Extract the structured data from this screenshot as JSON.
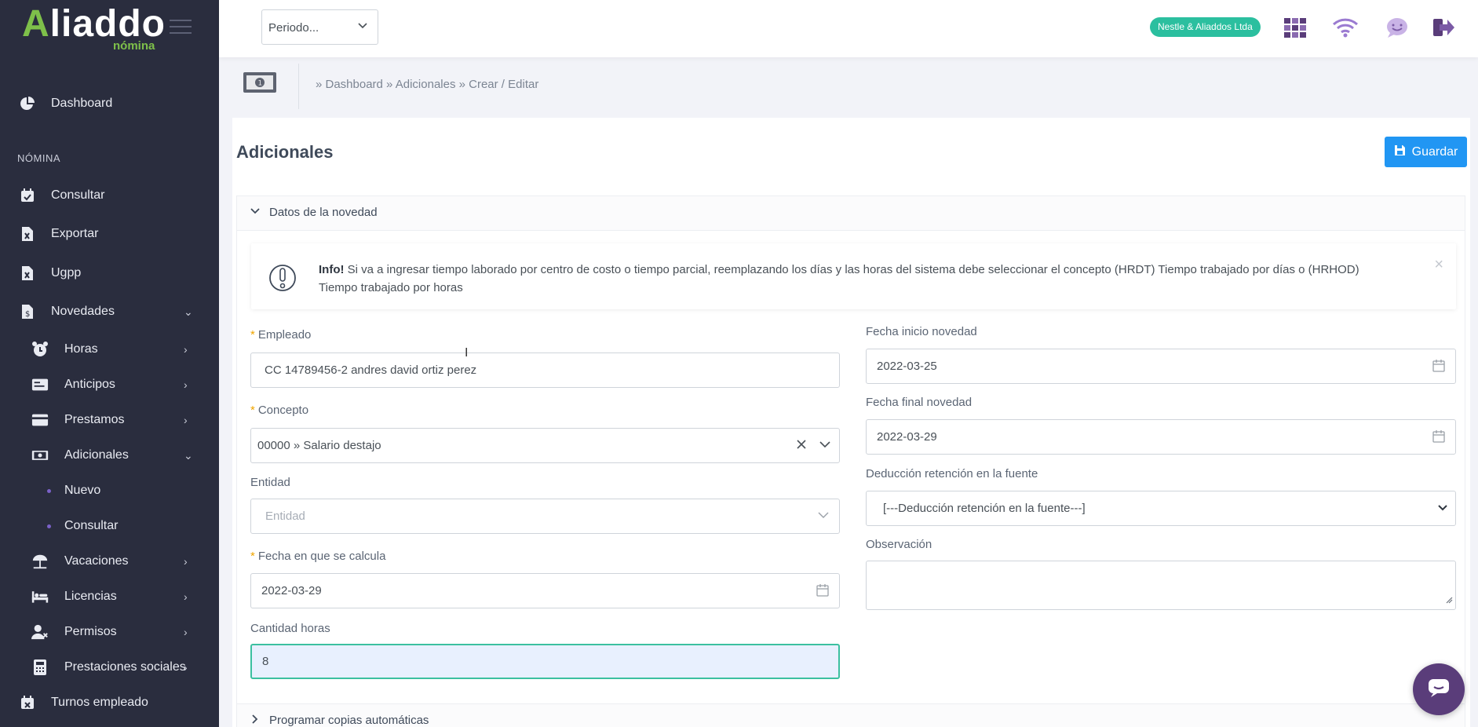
{
  "app": {
    "logo_text": "Aliaddo",
    "logo_sub": "nómina"
  },
  "sidebar": {
    "section_label": "NÓMINA",
    "items": [
      {
        "label": "Dashboard",
        "icon": "pie-chart-icon"
      },
      {
        "label": "Consultar",
        "icon": "calendar-check-icon"
      },
      {
        "label": "Exportar",
        "icon": "excel-file-icon"
      },
      {
        "label": "Ugpp",
        "icon": "excel-file-icon"
      },
      {
        "label": "Novedades",
        "icon": "dollar-file-icon",
        "expanded": true
      },
      {
        "label": "Horas",
        "icon": "alarm-clock-icon"
      },
      {
        "label": "Anticipos",
        "icon": "card-icon"
      },
      {
        "label": "Prestamos",
        "icon": "credit-card-icon"
      },
      {
        "label": "Adicionales",
        "icon": "banknote-icon",
        "expanded": true
      },
      {
        "label": "Nuevo"
      },
      {
        "label": "Consultar"
      },
      {
        "label": "Vacaciones",
        "icon": "beach-umbrella-icon"
      },
      {
        "label": "Licencias",
        "icon": "bed-icon"
      },
      {
        "label": "Permisos",
        "icon": "user-x-icon"
      },
      {
        "label": "Prestaciones sociales",
        "icon": "calculator-icon"
      },
      {
        "label": "Turnos empleado",
        "icon": "calendar-x-icon"
      }
    ]
  },
  "topbar": {
    "periodo_placeholder": "Periodo...",
    "company": "Nestle & Aliaddos Ltda",
    "icons": [
      "apps-grid-icon",
      "wifi-icon",
      "chat-smile-icon",
      "logout-icon"
    ]
  },
  "breadcrumb": {
    "text": "» Dashboard » Adicionales » Crear / Editar"
  },
  "page": {
    "title": "Adicionales",
    "save_label": "Guardar",
    "section_title": "Datos de la novedad",
    "footer_section_title": "Programar copias automáticas",
    "alert": {
      "title": "Info!",
      "message": "Si va a ingresar tiempo laborado por centro de costo o tiempo parcial, reemplazando los días y las horas del sistema debe seleccionar el concepto (HRDT) Tiempo trabajado por días o (HRHOD) Tiempo trabajado por horas"
    }
  },
  "form": {
    "empleado": {
      "label": "Empleado",
      "value": "CC 14789456-2 andres david ortiz perez",
      "required": true
    },
    "concepto": {
      "label": "Concepto",
      "value": "00000 » Salario destajo",
      "required": true
    },
    "entidad": {
      "label": "Entidad",
      "placeholder": "Entidad"
    },
    "fecha_calcula": {
      "label": "Fecha en que se calcula",
      "value": "2022-03-29",
      "required": true
    },
    "cantidad_horas": {
      "label": "Cantidad horas",
      "value": "8"
    },
    "fecha_inicio": {
      "label": "Fecha inicio novedad",
      "value": "2022-03-25"
    },
    "fecha_final": {
      "label": "Fecha final novedad",
      "value": "2022-03-29"
    },
    "deduccion": {
      "label": "Deducción retención en la fuente",
      "value": "[---Deducción retención en la fuente---]"
    },
    "observacion": {
      "label": "Observación",
      "value": ""
    }
  },
  "colors": {
    "sidebar_bg": "#2a2d3e",
    "accent_blue": "#2196f3",
    "badge_teal": "#2bbf9f",
    "logo_green": "#7ec04a",
    "chat_purple": "#5a3d7a"
  }
}
